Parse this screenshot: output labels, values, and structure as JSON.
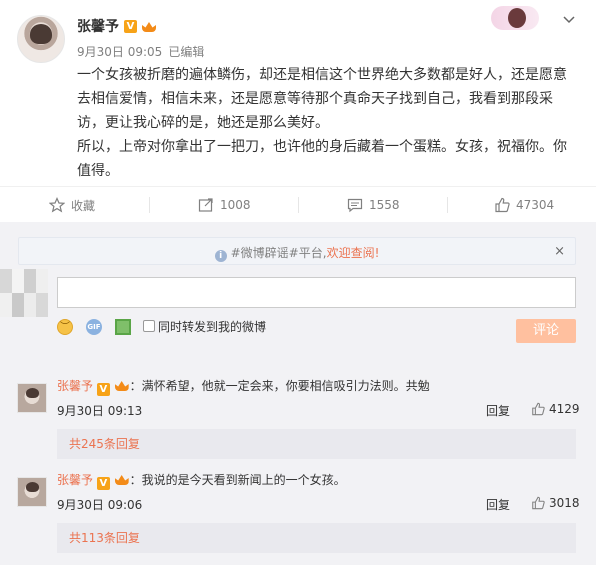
{
  "post": {
    "username": "张馨予",
    "verified_badge": "V",
    "date": "9月30日 09:05",
    "edited": "已编辑",
    "lines": [
      "一个女孩被折磨的遍体鳞伤，却还是相信这个世界绝大多数都是好人，还是愿意",
      "去相信爱情，相信未来，还是愿意等待那个真命天子找到自己，我看到那段采",
      "访，更让我心碎的是，她还是那么美好。",
      "所以，上帝对你拿出了一把刀，也许他的身后藏着一个蛋糕。女孩，祝福你。你",
      "值得。"
    ]
  },
  "actions": {
    "favorite_label": "收藏",
    "repost_count": "1008",
    "comment_count": "1558",
    "like_count": "47304"
  },
  "notice": {
    "prefix": "#微博辟谣#平台,",
    "link": "欢迎查阅!",
    "close": "×"
  },
  "composer": {
    "gif_label": "GIF",
    "forward_label": "同时转发到我的微博",
    "submit_label": "评论"
  },
  "comments": [
    {
      "author": "张馨予",
      "badge": "V",
      "text": "：满怀希望，他就一定会来，你要相信吸引力法则。共勉",
      "time": "9月30日 09:13",
      "reply_label": "回复",
      "likes": "4129",
      "sub_replies": "共245条回复"
    },
    {
      "author": "张馨予",
      "badge": "V",
      "text": "：我说的是今天看到新闻上的一个女孩。",
      "time": "9月30日 09:06",
      "reply_label": "回复",
      "likes": "3018",
      "sub_replies": "共113条回复"
    }
  ],
  "colors": {
    "accent": "#eb7350",
    "badge": "#f7a318",
    "panel": "#f2f2f5",
    "submit": "#ffc09f"
  }
}
